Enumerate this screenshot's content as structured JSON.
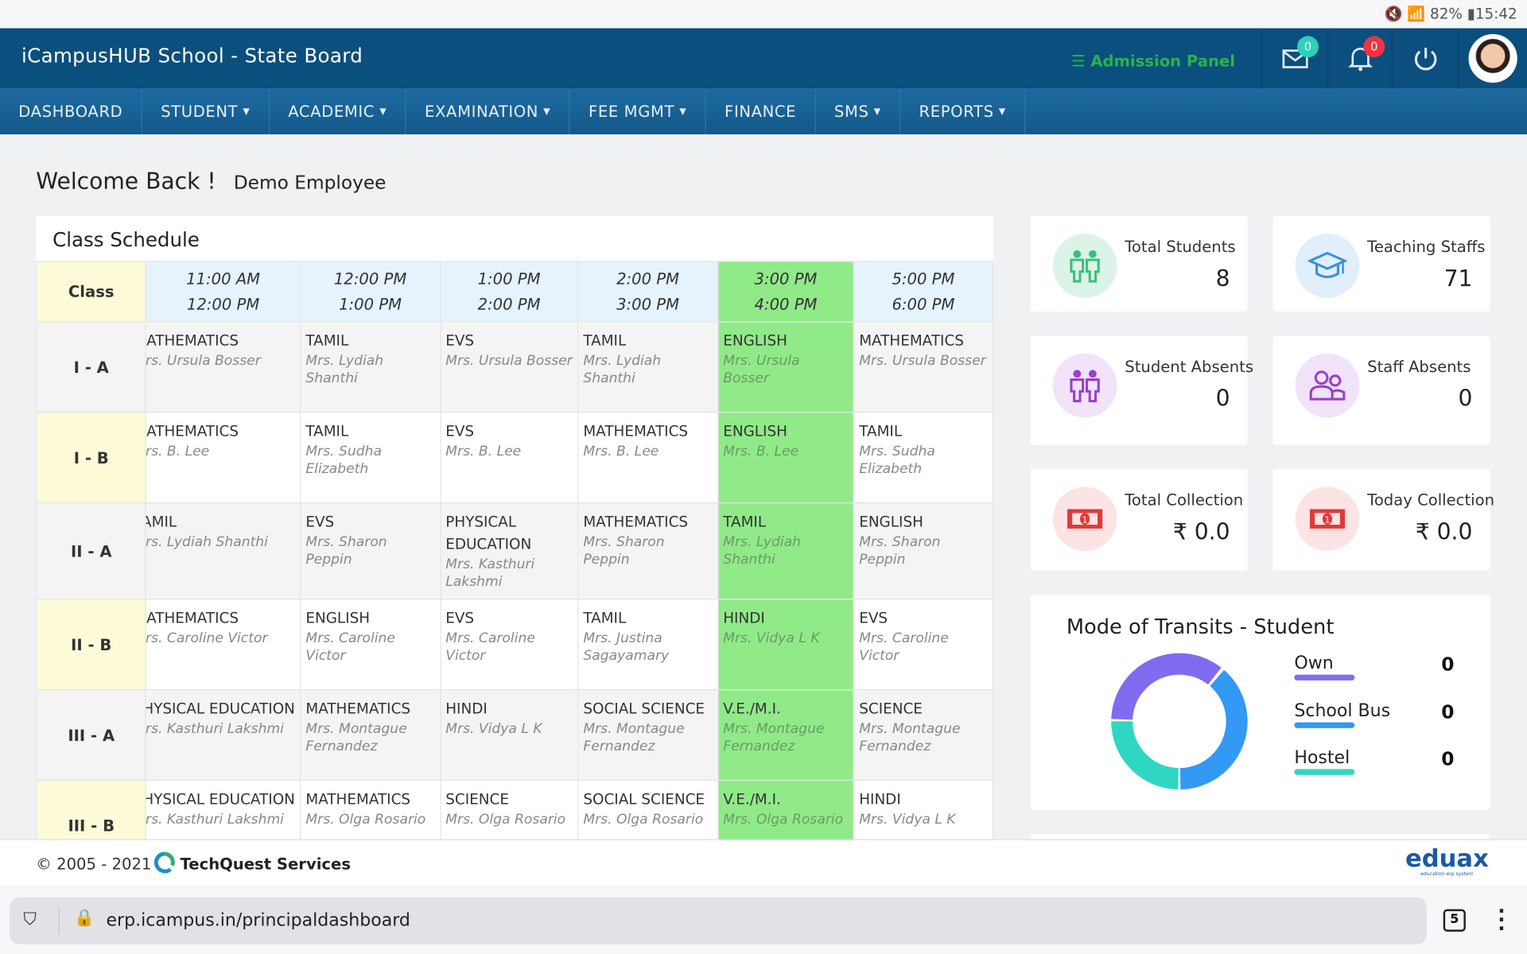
{
  "status_bar": {
    "battery": "82%",
    "time": "15:42"
  },
  "header": {
    "title": "iCampusHUB School - State Board",
    "admission_panel": "Admission Panel",
    "messages_count": "0",
    "notifications_count": "0"
  },
  "nav": [
    "DASHBOARD",
    "STUDENT",
    "ACADEMIC",
    "EXAMINATION",
    "FEE MGMT",
    "FINANCE",
    "SMS",
    "REPORTS"
  ],
  "nav_dropdown": [
    false,
    true,
    true,
    true,
    true,
    false,
    true,
    true
  ],
  "welcome": {
    "greeting": "Welcome Back !",
    "user": "Demo Employee"
  },
  "schedule": {
    "title": "Class Schedule",
    "class_header": "Class",
    "slots": [
      [
        "11:00 AM",
        "12:00 PM"
      ],
      [
        "12:00 PM",
        "1:00 PM"
      ],
      [
        "1:00 PM",
        "2:00 PM"
      ],
      [
        "2:00 PM",
        "3:00 PM"
      ],
      [
        "3:00 PM",
        "4:00 PM"
      ],
      [
        "5:00 PM",
        "6:00 PM"
      ]
    ],
    "highlight_slot": 4,
    "highlight_color": "#90ea88",
    "rows": [
      {
        "class": "I - A",
        "cells": [
          [
            "MATHEMATICS",
            "Mrs. Ursula Bosser"
          ],
          [
            "TAMIL",
            "Mrs. Lydiah Shanthi"
          ],
          [
            "EVS",
            "Mrs. Ursula Bosser"
          ],
          [
            "TAMIL",
            "Mrs. Lydiah Shanthi"
          ],
          [
            "ENGLISH",
            "Mrs. Ursula Bosser"
          ],
          [
            "MATHEMATICS",
            "Mrs. Ursula Bosser"
          ]
        ]
      },
      {
        "class": "I - B",
        "cells": [
          [
            "MATHEMATICS",
            "Mrs. B. Lee"
          ],
          [
            "TAMIL",
            "Mrs. Sudha Elizabeth"
          ],
          [
            "EVS",
            "Mrs. B. Lee"
          ],
          [
            "MATHEMATICS",
            "Mrs. B. Lee"
          ],
          [
            "ENGLISH",
            "Mrs. B. Lee"
          ],
          [
            "TAMIL",
            "Mrs. Sudha Elizabeth"
          ]
        ]
      },
      {
        "class": "II - A",
        "cells": [
          [
            "TAMIL",
            "Mrs. Lydiah Shanthi"
          ],
          [
            "EVS",
            "Mrs. Sharon Peppin"
          ],
          [
            "PHYSICAL EDUCATION",
            "Mrs. Kasthuri Lakshmi"
          ],
          [
            "MATHEMATICS",
            "Mrs. Sharon Peppin"
          ],
          [
            "TAMIL",
            "Mrs. Lydiah Shanthi"
          ],
          [
            "ENGLISH",
            "Mrs. Sharon Peppin"
          ]
        ]
      },
      {
        "class": "II - B",
        "cells": [
          [
            "MATHEMATICS",
            "Mrs. Caroline Victor"
          ],
          [
            "ENGLISH",
            "Mrs. Caroline Victor"
          ],
          [
            "EVS",
            "Mrs. Caroline Victor"
          ],
          [
            "TAMIL",
            "Mrs. Justina Sagayamary"
          ],
          [
            "HINDI",
            "Mrs. Vidya L K"
          ],
          [
            "EVS",
            "Mrs. Caroline Victor"
          ]
        ]
      },
      {
        "class": "III - A",
        "cells": [
          [
            "PHYSICAL EDUCATION",
            "Mrs. Kasthuri Lakshmi"
          ],
          [
            "MATHEMATICS",
            "Mrs. Montague Fernandez"
          ],
          [
            "HINDI",
            "Mrs. Vidya L K"
          ],
          [
            "SOCIAL SCIENCE",
            "Mrs. Montague Fernandez"
          ],
          [
            "V.E./M.I.",
            "Mrs. Montague Fernandez"
          ],
          [
            "SCIENCE",
            "Mrs. Montague Fernandez"
          ]
        ]
      },
      {
        "class": "III - B",
        "cells": [
          [
            "PHYSICAL EDUCATION",
            "Mrs. Kasthuri Lakshmi"
          ],
          [
            "MATHEMATICS",
            "Mrs. Olga Rosario"
          ],
          [
            "SCIENCE",
            "Mrs. Olga Rosario"
          ],
          [
            "SOCIAL SCIENCE",
            "Mrs. Olga Rosario"
          ],
          [
            "V.E./M.I.",
            "Mrs. Olga Rosario"
          ],
          [
            "HINDI",
            "Mrs. Vidya L K"
          ]
        ]
      }
    ]
  },
  "stats": [
    {
      "label": "Total Students",
      "value": "8",
      "icon": "students-icon",
      "color": "#3cbf7a",
      "bg": "#dcf4e7"
    },
    {
      "label": "Teaching Staffs",
      "value": "71",
      "icon": "graduation-cap-icon",
      "color": "#3b8fe0",
      "bg": "#e1effc"
    },
    {
      "label": "Student Absents",
      "value": "0",
      "icon": "students-icon",
      "color": "#9a3fc9",
      "bg": "#f1e3f9"
    },
    {
      "label": "Staff Absents",
      "value": "0",
      "icon": "staff-icon",
      "color": "#9a3fc9",
      "bg": "#f1e3f9"
    },
    {
      "label": "Total Collection",
      "value": "₹ 0.0",
      "icon": "money-icon",
      "color": "#e03a3a",
      "bg": "#fde4e4"
    },
    {
      "label": "Today Collection",
      "value": "₹ 0.0",
      "icon": "money-icon",
      "color": "#e03a3a",
      "bg": "#fde4e4"
    }
  ],
  "chart_data": {
    "type": "pie",
    "title": "Mode of Transits - Student",
    "categories": [
      "Own",
      "School Bus",
      "Hostel"
    ],
    "values": [
      0,
      0,
      0
    ],
    "colors": [
      "#7f6cf0",
      "#3399f5",
      "#2fd6c4"
    ],
    "legend": "right"
  },
  "footer": {
    "copyright": "© 2005 - 2021",
    "company": "TechQuest Services",
    "logo": "eduax",
    "logo_tagline": "education erp system"
  },
  "browser": {
    "url": "erp.icampus.in/principaldashboard",
    "tabs_count": "5"
  }
}
